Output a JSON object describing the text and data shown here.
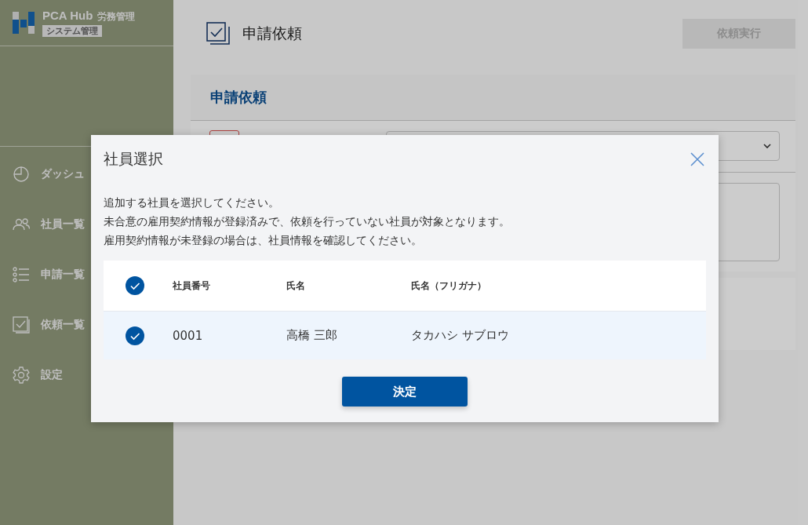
{
  "sidebar": {
    "logo": {
      "brand": "PCA Hub",
      "product": "労務管理",
      "badge": "システム管理"
    },
    "items": [
      {
        "kind": "dashboard",
        "label": "ダッシュ"
      },
      {
        "kind": "people",
        "label": "社員一覧"
      },
      {
        "kind": "list",
        "label": "申請一覧"
      },
      {
        "kind": "check",
        "label": "依頼一覧"
      },
      {
        "kind": "gear",
        "label": "設定"
      }
    ]
  },
  "header": {
    "title": "申請依頼",
    "action": {
      "label": "依頼実行",
      "disabled": true
    }
  },
  "card": {
    "title": "申請依頼"
  },
  "dialog": {
    "title": "社員選択",
    "description": [
      "追加する社員を選択してください。",
      "未合意の雇用契約情報が登録済みで、依頼を行っていない社員が対象となります。",
      "雇用契約情報が未登録の場合は、社員情報を確認してください。"
    ],
    "table": {
      "all_checked": true,
      "columns": [
        "社員番号",
        "氏名",
        "氏名（フリガナ）"
      ],
      "rows": [
        {
          "checked": true,
          "cells": [
            "0001",
            "高橋 三郎",
            "タカハシ サブロウ"
          ]
        }
      ]
    },
    "confirm": "決定"
  }
}
